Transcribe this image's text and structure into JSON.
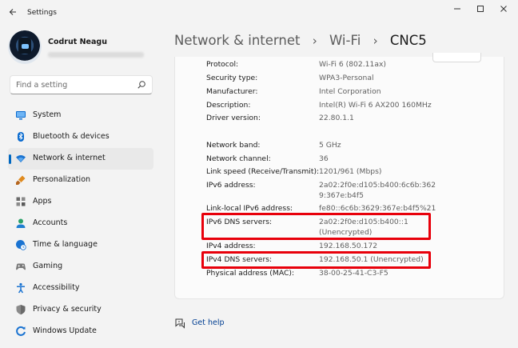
{
  "window": {
    "title": "Settings",
    "back_icon": "back-arrow-icon",
    "controls": [
      "minimize-icon",
      "maximize-icon",
      "close-icon"
    ]
  },
  "profile": {
    "name": "Codrut Neagu",
    "email_redacted": true
  },
  "search": {
    "placeholder": "Find a setting",
    "icon": "search-icon"
  },
  "nav": {
    "items": [
      {
        "label": "System",
        "icon": "monitor-icon",
        "color": "#0a6bcf"
      },
      {
        "label": "Bluetooth & devices",
        "icon": "bluetooth-icon",
        "color": "#0a6bcf"
      },
      {
        "label": "Network & internet",
        "icon": "wifi-icon",
        "color": "#1a73d1",
        "active": true
      },
      {
        "label": "Personalization",
        "icon": "paintbrush-icon",
        "color": "#e08a1e"
      },
      {
        "label": "Apps",
        "icon": "apps-icon",
        "color": "#5a5a5a"
      },
      {
        "label": "Accounts",
        "icon": "account-icon",
        "color": "#2aa169"
      },
      {
        "label": "Time & language",
        "icon": "globe-clock-icon",
        "color": "#1a73d1"
      },
      {
        "label": "Gaming",
        "icon": "gamepad-icon",
        "color": "#7a7a7a"
      },
      {
        "label": "Accessibility",
        "icon": "accessibility-icon",
        "color": "#1a73d1"
      },
      {
        "label": "Privacy & security",
        "icon": "shield-icon",
        "color": "#8a8a8a"
      },
      {
        "label": "Windows Update",
        "icon": "windows-update-icon",
        "color": "#1a73d1"
      }
    ]
  },
  "breadcrumb": {
    "items": [
      "Network & internet",
      "Wi-Fi",
      "CNC5"
    ],
    "separator": "›"
  },
  "properties": {
    "rows": [
      {
        "label": "Protocol:",
        "value": "Wi-Fi 6 (802.11ax)"
      },
      {
        "label": "Security type:",
        "value": "WPA3-Personal"
      },
      {
        "label": "Manufacturer:",
        "value": "Intel Corporation"
      },
      {
        "label": "Description:",
        "value": "Intel(R) Wi-Fi 6 AX200 160MHz"
      },
      {
        "label": "Driver version:",
        "value": "22.80.1.1"
      },
      {
        "label": "Network band:",
        "value": "5 GHz"
      },
      {
        "label": "Network channel:",
        "value": "36"
      },
      {
        "label": "Link speed (Receive/Transmit):",
        "value": "1201/961 (Mbps)"
      },
      {
        "label": "IPv6 address:",
        "value": "2a02:2f0e:d105:b400:6c6b:362",
        "value2": "9:367e:b4f5"
      },
      {
        "label": "Link-local IPv6 address:",
        "value": "fe80::6c6b:3629:367e:b4f5%21"
      },
      {
        "label": "IPv6 DNS servers:",
        "value": "2a02:2f0e:d105:b400::1",
        "value2": "(Unencrypted)",
        "highlighted": true
      },
      {
        "label": "IPv4 address:",
        "value": "192.168.50.172"
      },
      {
        "label": "IPv4 DNS servers:",
        "value": "192.168.50.1 (Unencrypted)",
        "highlighted": true
      },
      {
        "label": "Physical address (MAC):",
        "value": "38-00-25-41-C3-F5"
      }
    ]
  },
  "help": {
    "label": "Get help",
    "icon": "help-chat-icon"
  },
  "colors": {
    "accent": "#0067c0",
    "highlight": "#e8000b",
    "link": "#003e92",
    "background": "#f3f3f3"
  }
}
